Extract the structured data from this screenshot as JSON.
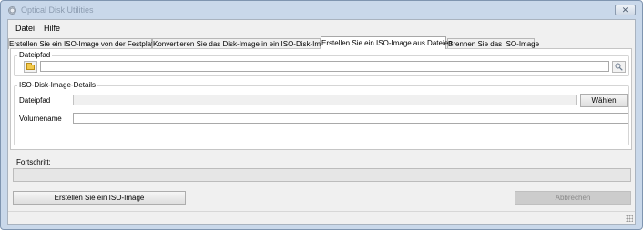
{
  "window": {
    "title": "Optical Disk Utilities",
    "close_glyph": "✕"
  },
  "menu": [
    {
      "label": "Datei"
    },
    {
      "label": "Hilfe"
    }
  ],
  "tabs": [
    {
      "label": "Erstellen Sie ein ISO-Image von der Festplatte",
      "active": false
    },
    {
      "label": "Konvertieren Sie das Disk-Image in ein ISO-Disk-Image",
      "active": false
    },
    {
      "label": "Erstellen Sie ein ISO-Image aus Dateien",
      "active": true
    },
    {
      "label": "Brennen Sie das ISO-Image",
      "active": false
    }
  ],
  "source_group": {
    "label": "Dateipfad",
    "path_value": "",
    "folder_icon": "folder-icon",
    "search_icon": "search-icon"
  },
  "details_group": {
    "label": "ISO-Disk-Image-Details",
    "path_label": "Dateipfad",
    "path_value": "",
    "browse_label": "Wählen",
    "volume_label": "Volumename",
    "volume_value": ""
  },
  "progress": {
    "label": "Fortschritt:",
    "value": 0
  },
  "actions": {
    "create_label": "Erstellen Sie ein ISO-Image",
    "cancel_label": "Abbrechen"
  },
  "colors": {
    "progress_fill": "#06b025",
    "window_frame": "#c9d8ea"
  }
}
